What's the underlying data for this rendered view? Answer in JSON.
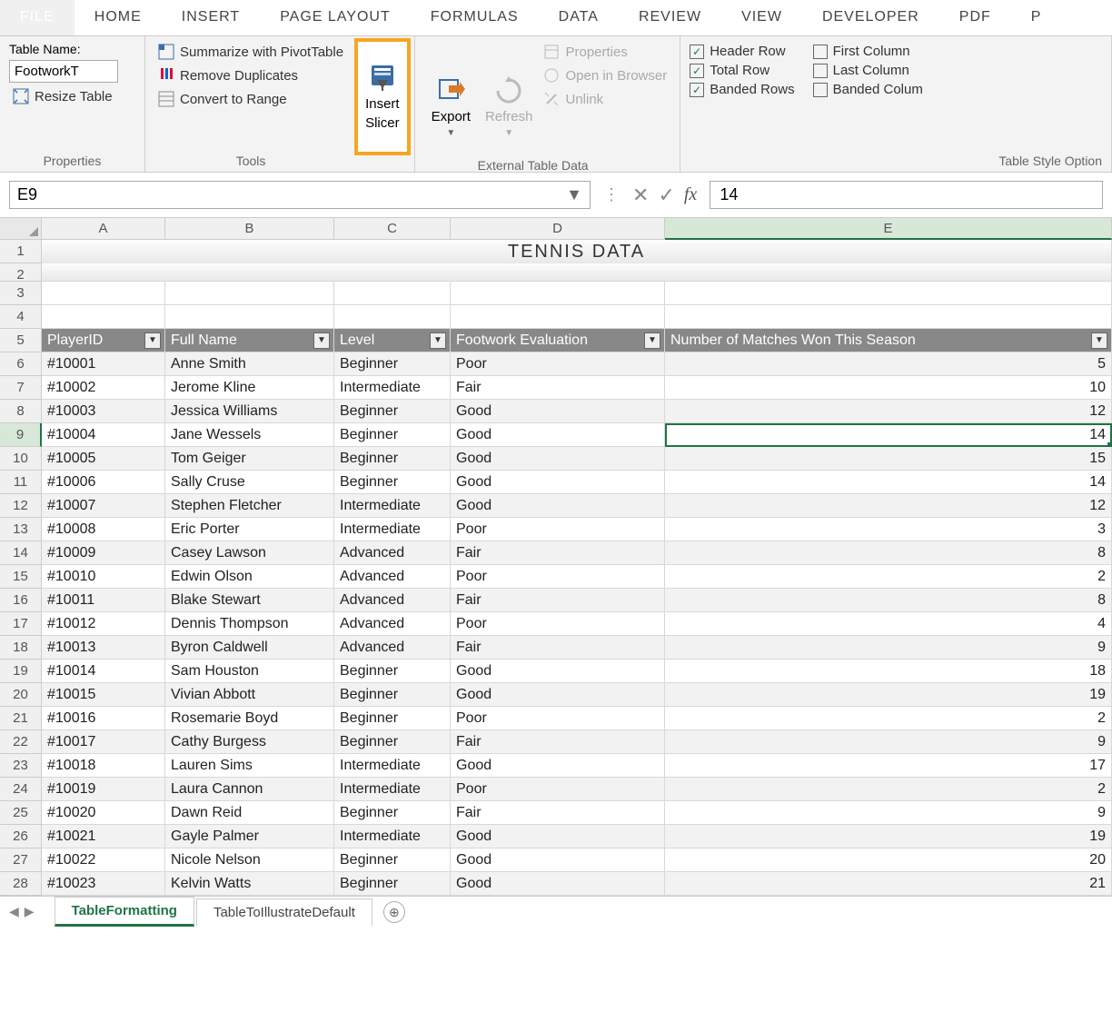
{
  "menu": {
    "file": "FILE",
    "tabs": [
      "HOME",
      "INSERT",
      "PAGE LAYOUT",
      "FORMULAS",
      "DATA",
      "REVIEW",
      "VIEW",
      "DEVELOPER",
      "PDF",
      "P"
    ]
  },
  "ribbon": {
    "properties": {
      "table_name_label": "Table Name:",
      "table_name_value": "FootworkT",
      "resize_table": "Resize Table",
      "group_label": "Properties"
    },
    "tools": {
      "summarize": "Summarize with PivotTable",
      "remove_dup": "Remove Duplicates",
      "convert_range": "Convert to Range",
      "insert_slicer_l1": "Insert",
      "insert_slicer_l2": "Slicer",
      "group_label": "Tools"
    },
    "external": {
      "export": "Export",
      "refresh": "Refresh",
      "props": "Properties",
      "open_browser": "Open in Browser",
      "unlink": "Unlink",
      "group_label": "External Table Data"
    },
    "style_options": {
      "header_row": "Header Row",
      "total_row": "Total Row",
      "banded_rows": "Banded Rows",
      "first_column": "First Column",
      "last_column": "Last Column",
      "banded_columns": "Banded Colum",
      "group_label": "Table Style Option"
    }
  },
  "formula_bar": {
    "name_box": "E9",
    "value": "14"
  },
  "columns": [
    "A",
    "B",
    "C",
    "D",
    "E"
  ],
  "title": "TENNIS DATA",
  "table": {
    "headers": [
      "PlayerID",
      "Full Name",
      "Level",
      "Footwork Evaluation",
      "Number of Matches Won This Season"
    ],
    "rows": [
      {
        "n": 6,
        "id": "#10001",
        "name": "Anne Smith",
        "level": "Beginner",
        "foot": "Poor",
        "won": "5"
      },
      {
        "n": 7,
        "id": "#10002",
        "name": "Jerome Kline",
        "level": "Intermediate",
        "foot": "Fair",
        "won": "10"
      },
      {
        "n": 8,
        "id": "#10003",
        "name": "Jessica Williams",
        "level": "Beginner",
        "foot": "Good",
        "won": "12"
      },
      {
        "n": 9,
        "id": "#10004",
        "name": "Jane Wessels",
        "level": "Beginner",
        "foot": "Good",
        "won": "14"
      },
      {
        "n": 10,
        "id": "#10005",
        "name": "Tom Geiger",
        "level": "Beginner",
        "foot": "Good",
        "won": "15"
      },
      {
        "n": 11,
        "id": "#10006",
        "name": "Sally Cruse",
        "level": "Beginner",
        "foot": "Good",
        "won": "14"
      },
      {
        "n": 12,
        "id": "#10007",
        "name": "Stephen Fletcher",
        "level": "Intermediate",
        "foot": "Good",
        "won": "12"
      },
      {
        "n": 13,
        "id": "#10008",
        "name": "Eric Porter",
        "level": "Intermediate",
        "foot": "Poor",
        "won": "3"
      },
      {
        "n": 14,
        "id": "#10009",
        "name": "Casey Lawson",
        "level": "Advanced",
        "foot": "Fair",
        "won": "8"
      },
      {
        "n": 15,
        "id": "#10010",
        "name": "Edwin Olson",
        "level": "Advanced",
        "foot": "Poor",
        "won": "2"
      },
      {
        "n": 16,
        "id": "#10011",
        "name": "Blake Stewart",
        "level": "Advanced",
        "foot": "Fair",
        "won": "8"
      },
      {
        "n": 17,
        "id": "#10012",
        "name": "Dennis Thompson",
        "level": "Advanced",
        "foot": "Poor",
        "won": "4"
      },
      {
        "n": 18,
        "id": "#10013",
        "name": "Byron Caldwell",
        "level": "Advanced",
        "foot": "Fair",
        "won": "9"
      },
      {
        "n": 19,
        "id": "#10014",
        "name": "Sam Houston",
        "level": "Beginner",
        "foot": "Good",
        "won": "18"
      },
      {
        "n": 20,
        "id": "#10015",
        "name": "Vivian Abbott",
        "level": "Beginner",
        "foot": "Good",
        "won": "19"
      },
      {
        "n": 21,
        "id": "#10016",
        "name": "Rosemarie Boyd",
        "level": "Beginner",
        "foot": "Poor",
        "won": "2"
      },
      {
        "n": 22,
        "id": "#10017",
        "name": "Cathy Burgess",
        "level": "Beginner",
        "foot": "Fair",
        "won": "9"
      },
      {
        "n": 23,
        "id": "#10018",
        "name": "Lauren Sims",
        "level": "Intermediate",
        "foot": "Good",
        "won": "17"
      },
      {
        "n": 24,
        "id": "#10019",
        "name": "Laura Cannon",
        "level": "Intermediate",
        "foot": "Poor",
        "won": "2"
      },
      {
        "n": 25,
        "id": "#10020",
        "name": "Dawn Reid",
        "level": "Beginner",
        "foot": "Fair",
        "won": "9"
      },
      {
        "n": 26,
        "id": "#10021",
        "name": "Gayle Palmer",
        "level": "Intermediate",
        "foot": "Good",
        "won": "19"
      },
      {
        "n": 27,
        "id": "#10022",
        "name": "Nicole Nelson",
        "level": "Beginner",
        "foot": "Good",
        "won": "20"
      },
      {
        "n": 28,
        "id": "#10023",
        "name": "Kelvin Watts",
        "level": "Beginner",
        "foot": "Good",
        "won": "21"
      }
    ]
  },
  "sheets": {
    "active": "TableFormatting",
    "other": "TableToIllustrateDefault"
  },
  "selected_row": 9
}
